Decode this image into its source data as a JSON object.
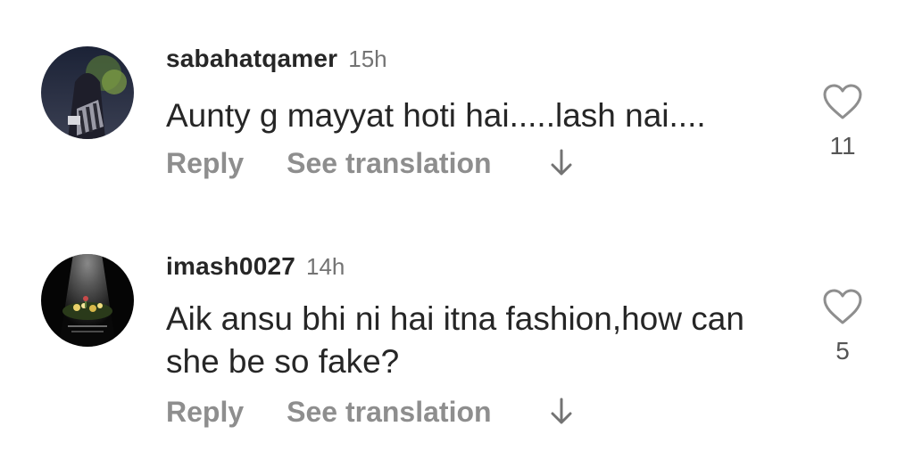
{
  "comments": [
    {
      "username": "sabahatqamer",
      "time": "15h",
      "text": "Aunty g mayyat hoti hai.....lash nai....",
      "reply_label": "Reply",
      "translate_label": "See translation",
      "likes": "11",
      "avatar_icon": "profile-photo",
      "heart_icon": "heart-outline-icon",
      "arrow_icon": "down-arrow-icon"
    },
    {
      "username": "imash0027",
      "time": "14h",
      "text": "Aik ansu bhi ni hai itna fashion,how can she be so fake?",
      "reply_label": "Reply",
      "translate_label": "See translation",
      "likes": "5",
      "avatar_icon": "profile-photo",
      "heart_icon": "heart-outline-icon",
      "arrow_icon": "down-arrow-icon"
    }
  ],
  "colors": {
    "text_primary": "#262626",
    "text_secondary": "#8e8e8e",
    "timestamp": "#737373",
    "background": "#ffffff"
  }
}
